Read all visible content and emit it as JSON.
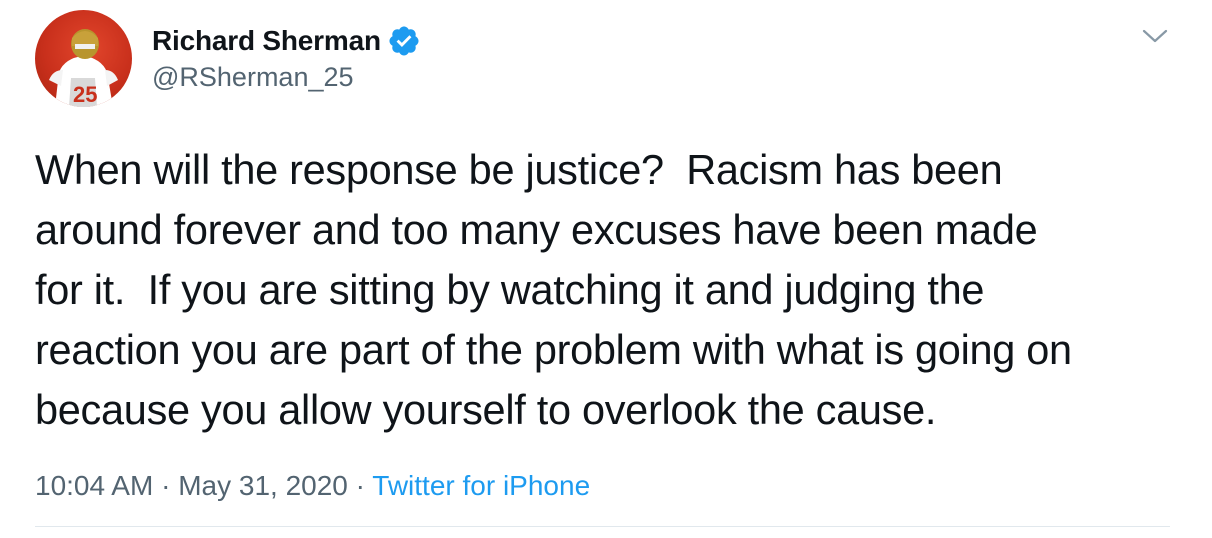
{
  "user": {
    "display_name": "Richard Sherman",
    "handle": "@RSherman_25",
    "verified": true
  },
  "tweet": {
    "text": "When will the response be justice?  Racism has been\naround forever and too many excuses have been made\nfor it.  If you are sitting by watching it and judging the\nreaction you are part of the problem with what is going on\nbecause you allow yourself to overlook the cause.",
    "time": "10:04 AM",
    "date": "May 31, 2020",
    "separator": "·",
    "source": "Twitter for iPhone"
  },
  "icons": {
    "verified": "verified-badge-icon",
    "menu": "chevron-down-icon"
  },
  "colors": {
    "link": "#1d9bf0",
    "secondary_text": "#536471",
    "primary_text": "#0f1419",
    "avatar_background": "#c9301c"
  }
}
